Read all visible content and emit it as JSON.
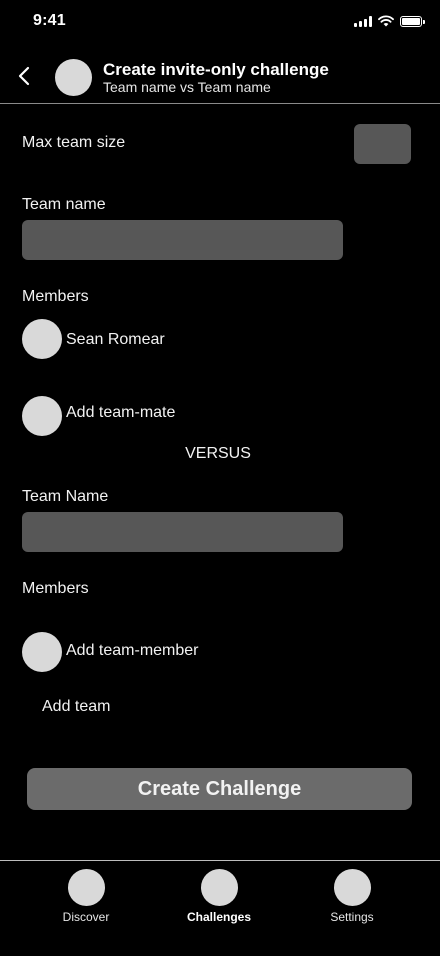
{
  "status_bar": {
    "time": "9:41"
  },
  "header": {
    "title": "Create invite-only challenge",
    "subtitle": "Team name vs Team name"
  },
  "form": {
    "max_team_size_label": "Max team size",
    "team1": {
      "name_label": "Team name",
      "name_value": "",
      "members_label": "Members",
      "members": [
        "Sean Romear"
      ],
      "add_label": "Add team-mate"
    },
    "versus_label": "VERSUS",
    "team2": {
      "name_label": "Team Name",
      "name_value": "",
      "members_label": "Members",
      "add_label": "Add team-member"
    },
    "add_team_label": "Add team"
  },
  "create_button_label": "Create Challenge",
  "tabs": [
    {
      "label": "Discover",
      "active": false
    },
    {
      "label": "Challenges",
      "active": true
    },
    {
      "label": "Settings",
      "active": false
    }
  ],
  "colors": {
    "background": "#000000",
    "input_fill": "#575757",
    "button_fill": "#6b6b6b",
    "placeholder_avatar": "#d9d9d9"
  }
}
